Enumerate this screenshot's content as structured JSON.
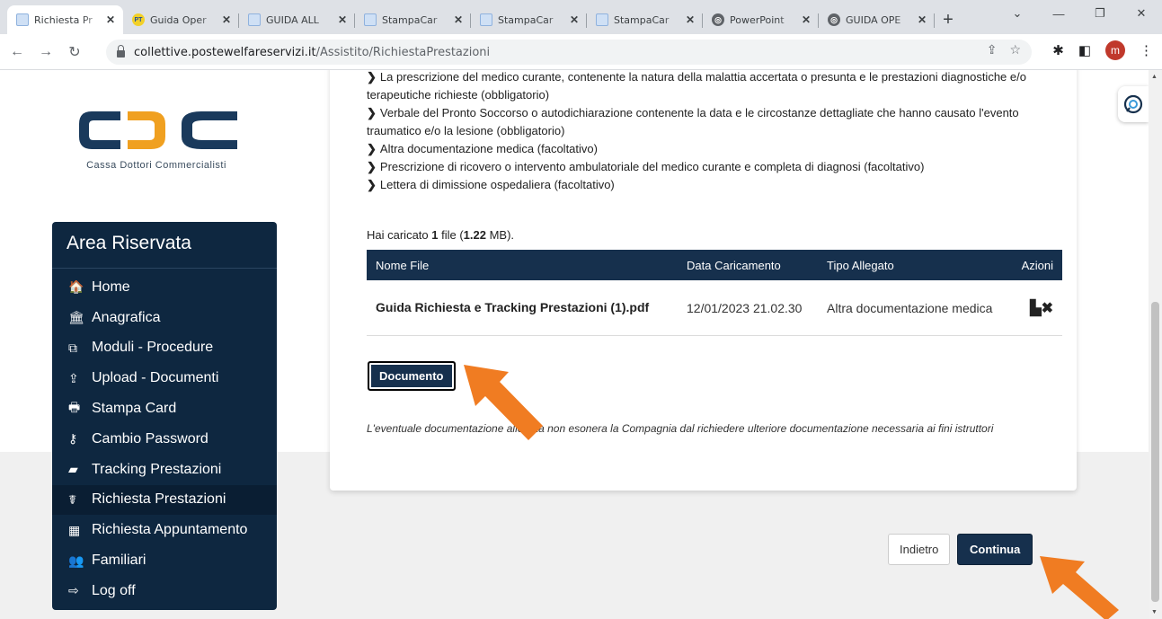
{
  "browser": {
    "tabs": [
      {
        "title": "Richiesta Pr",
        "icon": "doc-icon",
        "active": true
      },
      {
        "title": "Guida Oper",
        "icon": "pt-icon"
      },
      {
        "title": "GUIDA ALL",
        "icon": "doc-icon"
      },
      {
        "title": "StampaCar",
        "icon": "doc-icon"
      },
      {
        "title": "StampaCar",
        "icon": "doc-icon"
      },
      {
        "title": "StampaCar",
        "icon": "doc-icon"
      },
      {
        "title": "PowerPoint",
        "icon": "globe-icon"
      },
      {
        "title": "GUIDA OPE",
        "icon": "globe-icon"
      }
    ],
    "url_host": "collettive.postewelfareservizi.it",
    "url_path": "/Assistito/RichiestaPrestazioni",
    "avatar_letter": "m"
  },
  "logo": {
    "subtitle": "Cassa Dottori Commercialisti",
    "color_dark": "#1a3a5c",
    "color_accent": "#f0a020"
  },
  "sidebar": {
    "title": "Area Riservata",
    "items": [
      {
        "label": "Home",
        "icon": "home-icon",
        "glyph": "🏠"
      },
      {
        "label": "Anagrafica",
        "icon": "bank-icon",
        "glyph": "🏛"
      },
      {
        "label": "Moduli - Procedure",
        "icon": "copy-icon",
        "glyph": "⧉"
      },
      {
        "label": "Upload - Documenti",
        "icon": "upload-icon",
        "glyph": "⇪"
      },
      {
        "label": "Stampa Card",
        "icon": "print-icon",
        "glyph": "🖶"
      },
      {
        "label": "Cambio Password",
        "icon": "key-icon",
        "glyph": "⚷"
      },
      {
        "label": "Tracking Prestazioni",
        "icon": "book-icon",
        "glyph": "▰"
      },
      {
        "label": "Richiesta Prestazioni",
        "icon": "stethoscope-icon",
        "glyph": "☤",
        "active": true
      },
      {
        "label": "Richiesta Appuntamento",
        "icon": "calendar-icon",
        "glyph": "▦"
      },
      {
        "label": "Familiari",
        "icon": "users-icon",
        "glyph": "👥"
      },
      {
        "label": "Log off",
        "icon": "logout-icon",
        "glyph": "⇨"
      }
    ]
  },
  "requirements": [
    "La prescrizione del medico curante, contenente la natura della malattia accertata o presunta e le prestazioni diagnostiche e/o terapeutiche richieste (obbligatorio)",
    "Verbale del Pronto Soccorso o autodichiarazione contenente la data e le circostanze dettagliate che hanno causato l'evento traumatico e/o la lesione (obbligatorio)",
    "Altra documentazione medica (facoltativo)",
    "Prescrizione di ricovero o intervento ambulatoriale del medico curante e completa di diagnosi (facoltativo)",
    "Lettera di dimissione ospedaliera (facoltativo)"
  ],
  "upload": {
    "prefix": "Hai caricato ",
    "count": "1",
    "middle": " file (",
    "size": "1.22",
    "suffix": " MB)."
  },
  "table": {
    "headers": [
      "Nome File",
      "Data Caricamento",
      "Tipo Allegato",
      "Azioni"
    ],
    "rows": [
      {
        "name": "Guida Richiesta e Tracking Prestazioni (1).pdf",
        "date": "12/01/2023 21.02.30",
        "type": "Altra documentazione medica"
      }
    ]
  },
  "buttons": {
    "documento": "Documento",
    "indietro": "Indietro",
    "continua": "Continua"
  },
  "disclaimer": "L'eventuale documentazione allegata non esonera la Compagnia dal richiedere ulteriore documentazione necessaria ai fini istruttori",
  "colors": {
    "navy": "#16304d",
    "sidebar": "#0e2740",
    "arrow": "#f07c22"
  }
}
